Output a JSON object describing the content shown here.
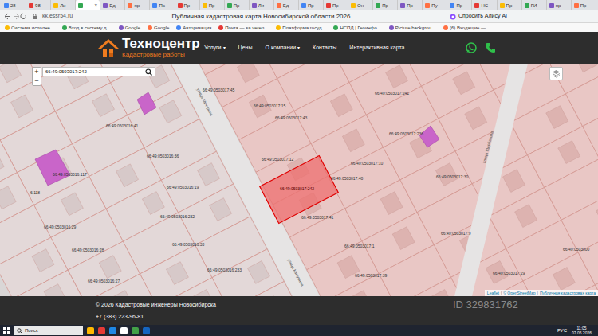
{
  "browser": {
    "tabs": [
      {
        "label": "28",
        "selected": false
      },
      {
        "label": "98",
        "selected": false
      },
      {
        "label": "Ли",
        "selected": false
      },
      {
        "label": "",
        "close": "×",
        "selected": true
      },
      {
        "label": "Ед",
        "selected": false
      },
      {
        "label": "пр",
        "selected": false
      },
      {
        "label": "По",
        "selected": false
      },
      {
        "label": "Пр",
        "selected": false
      },
      {
        "label": "Пр",
        "selected": false
      },
      {
        "label": "Пр",
        "selected": false
      },
      {
        "label": "Ли",
        "selected": false
      },
      {
        "label": "Ед",
        "selected": false
      },
      {
        "label": "Пр",
        "selected": false
      },
      {
        "label": "Пр",
        "selected": false
      },
      {
        "label": "Он",
        "selected": false
      },
      {
        "label": "Пр",
        "selected": false
      },
      {
        "label": "Пр",
        "selected": false
      },
      {
        "label": "Пу",
        "selected": false
      },
      {
        "label": "Пр",
        "selected": false
      },
      {
        "label": "НС",
        "selected": false
      },
      {
        "label": "Пр",
        "selected": false
      },
      {
        "label": "ГИ",
        "selected": false
      },
      {
        "label": "пр",
        "selected": false
      },
      {
        "label": "Пр",
        "selected": false
      }
    ],
    "address": "kk.essr54.ru",
    "title": "Публичная кадастровая карта Новосибирской области 2026",
    "assistant": "Спросить Алису AI",
    "bookmarks": [
      "Система исполне…",
      "Вход в систему д…",
      "Google",
      "Google",
      "Авторизация",
      "Почта — sa.veren…",
      "Платформа госуд…",
      "НСПД | Геоинфо…",
      "Picture backgrou…",
      "(6) Входящие — …"
    ]
  },
  "site": {
    "logo": {
      "name": "Техноцентр",
      "tagline": "Кадастровые работы"
    },
    "nav": [
      {
        "label": "Услуги",
        "caret": "▾"
      },
      {
        "label": "Цены"
      },
      {
        "label": "О компании",
        "caret": "▾"
      },
      {
        "label": "Контакты"
      },
      {
        "label": "Интерактивная карта"
      }
    ]
  },
  "map": {
    "search": {
      "value": "66:49:0503017:242"
    },
    "zoom": [
      "+",
      "−"
    ],
    "streets": [
      "улица Мичурина",
      "улица Мичурина",
      "улица Щербакова"
    ],
    "parcels": [
      {
        "label": "66:49:0503017:45",
        "selected": false
      },
      {
        "label": "66:49:0503017:15",
        "selected": false
      },
      {
        "label": "66:49:0503017:43",
        "selected": false
      },
      {
        "label": "66:49:0503017:241",
        "selected": false
      },
      {
        "label": "66:49:0503016:41",
        "selected": false
      },
      {
        "label": "66:49:0503017:236",
        "selected": false
      },
      {
        "label": "66:49:0503016:36",
        "selected": false
      },
      {
        "label": "66:49:0503017:12",
        "selected": false
      },
      {
        "label": "66:49:0503017:10",
        "selected": false
      },
      {
        "label": "66:49:0503016:117",
        "selected": false
      },
      {
        "label": "66:49:0503017:40",
        "selected": false
      },
      {
        "label": "66:49:0503017:30",
        "selected": false
      },
      {
        "label": "66:49:0503016:19",
        "selected": false
      },
      {
        "label": "66:49:0503017:242",
        "selected": true
      },
      {
        "label": "6:118",
        "selected": false
      },
      {
        "label": "66:49:0503016:232",
        "selected": false
      },
      {
        "label": "66:49:0503017:41",
        "selected": false
      },
      {
        "label": "66:49:0503016:29",
        "selected": false
      },
      {
        "label": "66:49:0503017:9",
        "selected": false
      },
      {
        "label": "66:49:0503016:33",
        "selected": false
      },
      {
        "label": "66:49:0503017:1",
        "selected": false
      },
      {
        "label": "66:49:0503016:28",
        "selected": false
      },
      {
        "label": "66:49:0503000",
        "selected": false
      },
      {
        "label": "66:49:0503016:233",
        "selected": false
      },
      {
        "label": "66:49:0503017:39",
        "selected": false
      },
      {
        "label": "66:49:0503017:29",
        "selected": false
      },
      {
        "label": "66:49:0503016:27",
        "selected": false
      }
    ],
    "attribution": [
      "Leaflet",
      "|",
      "© OpenStreetMap",
      "|",
      "Публичная кадастровая карта"
    ]
  },
  "footer": {
    "copyright": "© 2026 Кадастровые инженеры Новосибирска",
    "phone": "+7 (383) 223-96-81"
  },
  "watermark": "ID 329831762",
  "taskbar": {
    "search": "Поиск",
    "language": "РУС",
    "time": "11:05",
    "date": "07.05.2026"
  }
}
